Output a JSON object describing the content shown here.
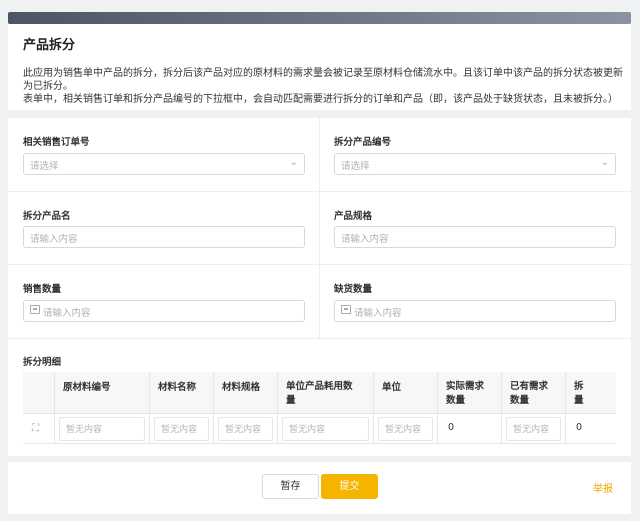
{
  "header": {
    "title": "产品拆分",
    "desc_line1": "此应用为销售单中产品的拆分，拆分后该产品对应的原材料的需求量会被记录至原材料仓储流水中。且该订单中该产品的拆分状态被更新",
    "desc_line2": "为已拆分。",
    "desc_line3": "表单中，相关销售订单和拆分产品编号的下拉框中，会自动匹配需要进行拆分的订单和产品（即，该产品处于缺货状态，且未被拆分。）"
  },
  "form": {
    "sales_order": {
      "label": "相关销售订单号",
      "placeholder": "请选择"
    },
    "split_product_no": {
      "label": "拆分产品编号",
      "placeholder": "请选择"
    },
    "split_product_name": {
      "label": "拆分产品名",
      "placeholder": "请输入内容"
    },
    "product_spec": {
      "label": "产品规格",
      "placeholder": "请输入内容"
    },
    "sales_qty": {
      "label": "销售数量",
      "placeholder": "请输入内容"
    },
    "shortage_qty": {
      "label": "缺货数量",
      "placeholder": "请输入内容"
    },
    "detail_label": "拆分明细"
  },
  "table": {
    "headers": [
      "原材料编号",
      "材料名称",
      "材料规格",
      "单位产品耗用数量",
      "单位",
      "实际需求数量",
      "已有需求数量",
      "拆分数量"
    ],
    "header_lines": [
      [
        "原材料编号"
      ],
      [
        "材料名称"
      ],
      [
        "材料规格"
      ],
      [
        "单位产品耗用数",
        "量"
      ],
      [
        "单位"
      ],
      [
        "实际需求",
        "数量"
      ],
      [
        "已有需求",
        "数量"
      ],
      [
        "拆",
        "量"
      ]
    ],
    "row": {
      "material_no": "暂无内容",
      "material_name": "暂无内容",
      "material_spec": "暂无内容",
      "unit_consumption": "暂无内容",
      "unit": "暂无内容",
      "actual_demand": "0",
      "existing_demand": "暂无内容",
      "split_qty": "0"
    }
  },
  "footer": {
    "save_label": "暂存",
    "submit_label": "提交",
    "report_label": "举报"
  },
  "colors": {
    "accent": "#f5b400",
    "report": "#f0a800"
  }
}
